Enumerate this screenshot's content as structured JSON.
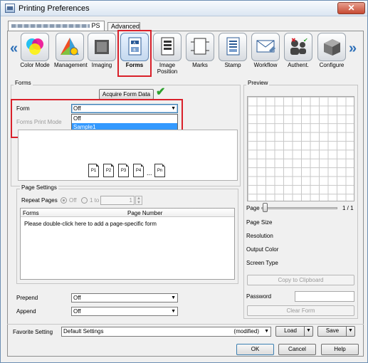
{
  "window": {
    "title": "Printing Preferences",
    "close_label": "✕"
  },
  "tabs": [
    {
      "label": "PS"
    },
    {
      "label": "Advanced"
    }
  ],
  "toolbar": {
    "prev_arrow": "«",
    "next_arrow": "»",
    "items": [
      {
        "label": "Color Mode",
        "icon": "color-mode-icon"
      },
      {
        "label": "Management",
        "icon": "management-icon"
      },
      {
        "label": "Imaging",
        "icon": "imaging-icon"
      },
      {
        "label": "Forms",
        "icon": "forms-icon",
        "active": true
      },
      {
        "label": "Image Position",
        "icon": "image-position-icon"
      },
      {
        "label": "Marks",
        "icon": "marks-icon"
      },
      {
        "label": "Stamp",
        "icon": "stamp-icon"
      },
      {
        "label": "Workflow",
        "icon": "workflow-icon"
      },
      {
        "label": "Authent.",
        "icon": "authentication-icon"
      },
      {
        "label": "Configure",
        "icon": "configure-icon"
      }
    ]
  },
  "forms": {
    "group_title": "Forms",
    "acquire_button": "Acquire Form Data",
    "form_label": "Form",
    "form_value": "Off",
    "form_options": [
      "Off",
      "Sample1"
    ],
    "print_mode_label": "Forms Print Mode",
    "pages": [
      "P1",
      "P2",
      "P3",
      "P4",
      "...",
      "Pn"
    ]
  },
  "page_settings": {
    "group_title": "Page Settings",
    "repeat_label": "Repeat Pages",
    "off_label": "Off",
    "one_to_label": "1 to",
    "repeat_value": "1",
    "columns": [
      "Forms",
      "Page Number"
    ],
    "hint": "Please double-click here to add a page-specific form"
  },
  "prepend": {
    "label": "Prepend",
    "value": "Off"
  },
  "append": {
    "label": "Append",
    "value": "Off"
  },
  "preview": {
    "title": "Preview",
    "page_label": "Page",
    "page_count": "1 / 1",
    "page_fraction": 0.0,
    "info": [
      "Page Size",
      "Resolution",
      "Output Color",
      "Screen Type"
    ],
    "copy_button": "Copy to Clipboard",
    "password_label": "Password",
    "clear_form_button": "Clear Form"
  },
  "favorite": {
    "label": "Favorite Setting",
    "value": "Default Settings",
    "modified": "(modified)",
    "load_button": "Load",
    "save_button": "Save"
  },
  "footer": {
    "ok": "OK",
    "cancel": "Cancel",
    "help": "Help"
  },
  "colors": {
    "highlight": "#d9202a",
    "selection": "#3399ff",
    "accent": "#2d6fb8",
    "check": "#2ea12e"
  }
}
